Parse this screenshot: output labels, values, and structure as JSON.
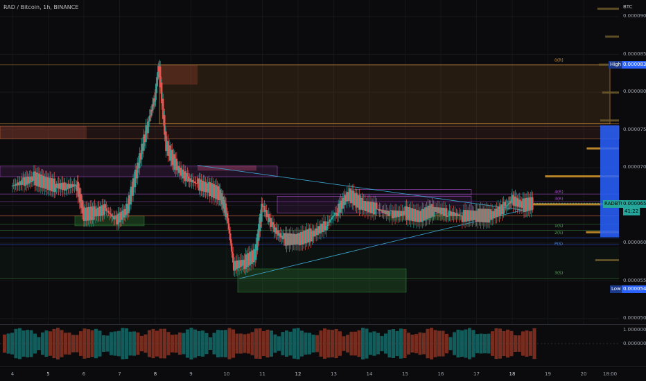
{
  "header": {
    "title": "RAD / Bitcoin, 1h, BINANCE",
    "currency": "BTC"
  },
  "colors": {
    "up": "#26a69a",
    "down": "#ef5350",
    "orange": "#e8a33a",
    "purple": "#a64dc8",
    "blue": "#2962ff",
    "green": "#2e7d32"
  },
  "axis": {
    "price_ticks": [
      "0.0000900",
      "0.0000850",
      "0.0000800",
      "0.0000750",
      "0.0000700",
      "0.0000650",
      "0.0000600",
      "0.0000550",
      "0.0000500"
    ],
    "x_ticks": [
      "4",
      "5",
      "6",
      "7",
      "8",
      "9",
      "10",
      "11",
      "12",
      "13",
      "14",
      "15",
      "16",
      "17",
      "18",
      "19",
      "20",
      "18:00"
    ],
    "osc_ticks": [
      "1.0000000",
      "0.0000000"
    ]
  },
  "tags": {
    "high_label": "High",
    "high_value": "0.0000836",
    "low_label": "Low",
    "low_value": "0.0000540",
    "symbol": "RADBTC",
    "last_price": "0.0000653",
    "countdown": "41:22"
  },
  "levels": {
    "r3": "0(R)",
    "r1": "4(R)",
    "r2": "3(R)",
    "pp": "P(S)",
    "s1": "1(S)",
    "s2": "2(S)",
    "s3": "3(S)"
  },
  "chart_data": {
    "type": "candlestick",
    "xlim": [
      "4",
      "18:00"
    ],
    "ylim": [
      5e-05,
      9e-05
    ],
    "high": 8.36e-05,
    "low": 5.4e-05,
    "last": 6.53e-05,
    "path": [
      [
        4,
        6.76e-05
      ],
      [
        4.3,
        6.81e-05
      ],
      [
        4.6,
        6.86e-05
      ],
      [
        4.9,
        6.8e-05
      ],
      [
        5.2,
        6.76e-05
      ],
      [
        5.5,
        6.75e-05
      ],
      [
        5.8,
        6.77e-05
      ],
      [
        6,
        6.38e-05
      ],
      [
        6.3,
        6.4e-05
      ],
      [
        6.6,
        6.45e-05
      ],
      [
        6.9,
        6.3e-05
      ],
      [
        7.2,
        6.43e-05
      ],
      [
        7.5,
        7e-05
      ],
      [
        7.8,
        7.6e-05
      ],
      [
        8,
        7.95e-05
      ],
      [
        8.1,
        8.36e-05
      ],
      [
        8.3,
        7.3e-05
      ],
      [
        8.6,
        7e-05
      ],
      [
        8.9,
        6.85e-05
      ],
      [
        9.2,
        6.78e-05
      ],
      [
        9.5,
        6.72e-05
      ],
      [
        9.8,
        6.65e-05
      ],
      [
        10,
        6.4e-05
      ],
      [
        10.2,
        5.7e-05
      ],
      [
        10.5,
        5.75e-05
      ],
      [
        10.8,
        5.85e-05
      ],
      [
        11,
        6.5e-05
      ],
      [
        11.3,
        6.2e-05
      ],
      [
        11.6,
        6.05e-05
      ],
      [
        12,
        6.05e-05
      ],
      [
        12.4,
        6.12e-05
      ],
      [
        12.8,
        6.25e-05
      ],
      [
        13.1,
        6.43e-05
      ],
      [
        13.4,
        6.65e-05
      ],
      [
        13.8,
        6.5e-05
      ],
      [
        14.2,
        6.45e-05
      ],
      [
        14.6,
        6.38e-05
      ],
      [
        15,
        6.4e-05
      ],
      [
        15.4,
        6.35e-05
      ],
      [
        15.8,
        6.45e-05
      ],
      [
        16.2,
        6.4e-05
      ],
      [
        16.6,
        6.36e-05
      ],
      [
        17,
        6.37e-05
      ],
      [
        17.4,
        6.36e-05
      ],
      [
        17.8,
        6.48e-05
      ],
      [
        18,
        6.57e-05
      ],
      [
        18.3,
        6.5e-05
      ],
      [
        18.6,
        6.53e-05
      ]
    ]
  }
}
